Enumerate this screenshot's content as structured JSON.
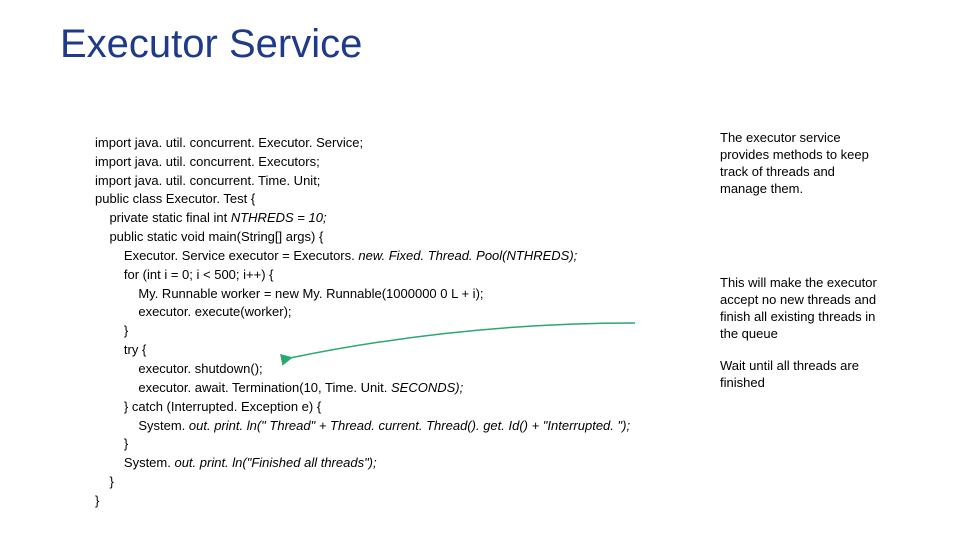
{
  "title": "Executor Service",
  "code": {
    "l1": "import java. util. concurrent. Executor. Service;",
    "l2": "import java. util. concurrent. Executors;",
    "l3": "import java. util. concurrent. Time. Unit;",
    "l4": "public class Executor. Test {",
    "l5": "    private static final int ",
    "l5i": "NTHREDS = 10;",
    "l6": "    public static void main(String[] args) {",
    "l7": "        Executor. Service executor = Executors. ",
    "l7i": "new. Fixed. Thread. Pool(NTHREDS);",
    "l8": "        for (int i = 0; i < 500; i++) {",
    "l9": "            My. Runnable worker = new My. Runnable(1000000 0 L + i);",
    "l10": "            executor. execute(worker);",
    "l11": "        }",
    "l12": "        try {",
    "l13": "            executor. shutdown();",
    "l14": "            executor. await. Termination(10, Time. Unit. ",
    "l14i": "SECONDS);",
    "l15": "        } catch (Interrupted. Exception e) {",
    "l16": "            System. ",
    "l16i": "out. print. ln(\" Thread\" + Thread. current. Thread(). get. Id() + \"Interrupted. \");",
    "l17": "        }",
    "l18": "        System. ",
    "l18i": "out. print. ln(\"Finished all threads\");",
    "l19": "    }",
    "l20": "}"
  },
  "notes": {
    "n1": "The executor service provides methods to keep track of threads and manage them.",
    "n2": "This will make the executor accept no new threads and finish all existing threads in the queue",
    "n3": "Wait until all threads are finished"
  },
  "arrow_color": "#2aa86f"
}
